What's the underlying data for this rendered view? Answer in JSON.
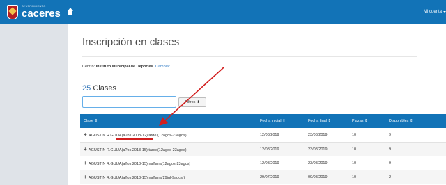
{
  "header": {
    "logo_small": "AYUNTAMIENTO",
    "logo_big": "caceres",
    "account_label": "Mi cuenta"
  },
  "page": {
    "title": "Inscripción en clases",
    "centro_label": "Centro:",
    "centro_name": "Instituto Municipal de Deportes",
    "centro_link": "Cambiar",
    "count": "25",
    "count_label": "Clases"
  },
  "search": {
    "value": ""
  },
  "filters_label": "Filtros",
  "table": {
    "headers": [
      "Clase ⇕",
      "Fecha inicial ⇕",
      "Fecha final ⇕",
      "Plazas ⇕",
      "Disponibles ⇕"
    ],
    "rows": [
      {
        "clase": "AGUSTIN R.GUIJA(a?os 2008-12)tarde (12agos-23agos)",
        "fecha_inicial": "12/08/2019",
        "fecha_final": "23/08/2019",
        "plazas": "10",
        "disponibles": "9"
      },
      {
        "clase": "AGUSTIN R.GUIJA(a?os 2013-15) tarde(12agos-23agos)",
        "fecha_inicial": "12/08/2019",
        "fecha_final": "23/08/2019",
        "plazas": "10",
        "disponibles": "9"
      },
      {
        "clase": "AGUSTIN R.GUIJA(años 2013-15)mañana(12agos-23agos)",
        "fecha_inicial": "12/08/2019",
        "fecha_final": "23/08/2019",
        "plazas": "10",
        "disponibles": "9"
      },
      {
        "clase": "AGUSTIN R.GUIJA(años 2013-15)mañana(29jul-9agos.)",
        "fecha_inicial": "29/07/2019",
        "fecha_final": "09/08/2019",
        "plazas": "10",
        "disponibles": "2"
      }
    ]
  },
  "colors": {
    "brand_blue": "#1273b7",
    "annotation_red": "#d21e1e"
  },
  "icons": [
    "home-icon",
    "plus-icon",
    "chevron-down-icon",
    "caret-down-icon"
  ]
}
